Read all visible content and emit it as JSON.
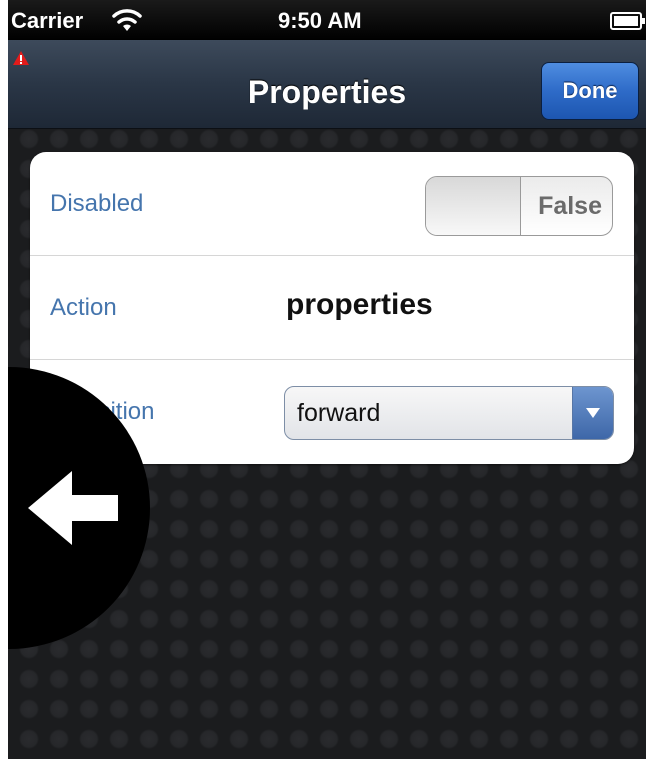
{
  "status_bar": {
    "carrier": "Carrier",
    "time": "9:50 AM",
    "wifi_icon": "wifi-icon",
    "battery_icon": "battery-icon"
  },
  "nav_bar": {
    "title": "Properties",
    "done_label": "Done",
    "warning_icon": "warning-icon",
    "accent": "#2e6bc8"
  },
  "properties": {
    "rows": [
      {
        "label": "Disabled",
        "type": "toggle",
        "value": "False"
      },
      {
        "label": "Action",
        "type": "text",
        "value": "properties"
      },
      {
        "label": "Transition",
        "type": "select",
        "value": "forward"
      }
    ],
    "label_color": "#4575ad"
  },
  "overlay": {
    "back_icon": "back-arrow-icon"
  }
}
